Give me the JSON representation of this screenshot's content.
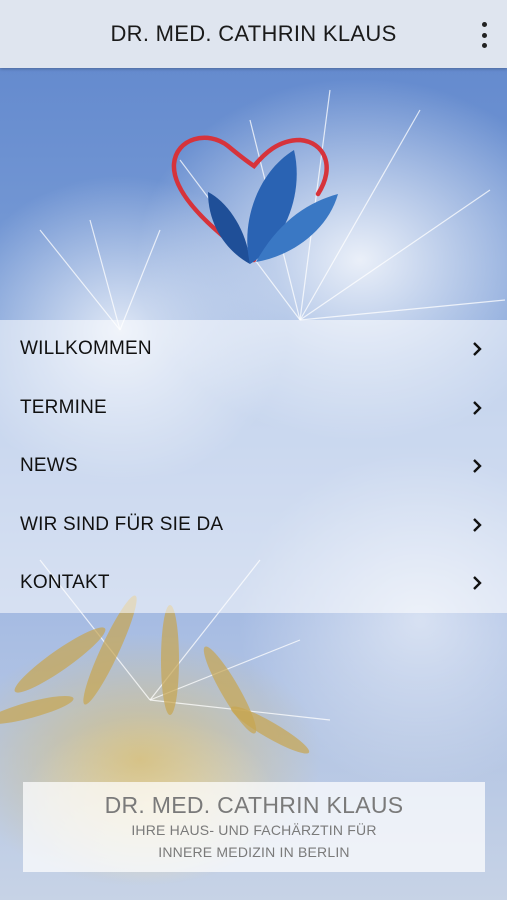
{
  "header": {
    "title": "DR. MED. CATHRIN KLAUS",
    "menu_icon": "more-vert-icon"
  },
  "nav": {
    "items": [
      {
        "label": "WILLKOMMEN",
        "icon": "chevron-right-icon"
      },
      {
        "label": "TERMINE",
        "icon": "chevron-right-icon"
      },
      {
        "label": "NEWS",
        "icon": "chevron-right-icon"
      },
      {
        "label": "WIR SIND FÜR SIE DA",
        "icon": "chevron-right-icon"
      },
      {
        "label": "KONTAKT",
        "icon": "chevron-right-icon"
      }
    ]
  },
  "footer": {
    "title": "DR. MED. CATHRIN KLAUS",
    "line1": "IHRE HAUS- UND FACHÄRZTIN FÜR",
    "line2": "INNERE MEDIZIN IN BERLIN"
  },
  "colors": {
    "header_bg": "#dfe5ef",
    "logo_heart": "#d6333b",
    "logo_leaf": "#1f4f98",
    "sky": "#6d92d2"
  }
}
